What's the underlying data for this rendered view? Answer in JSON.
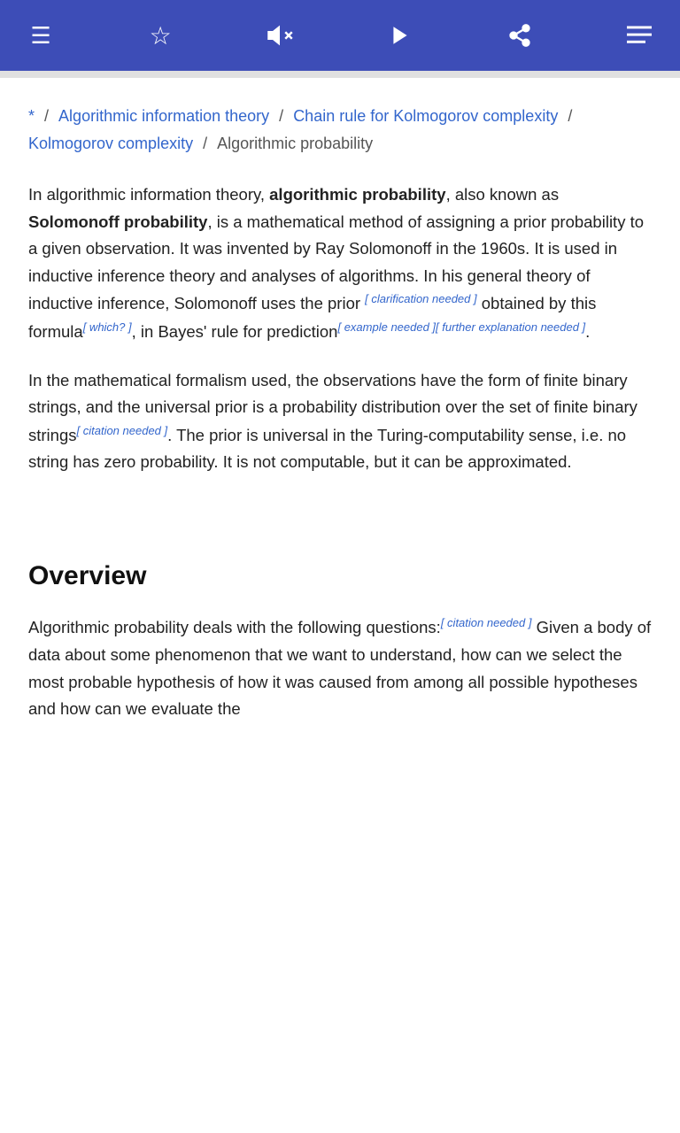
{
  "navbar": {
    "menu_icon": "☰",
    "star_icon": "☆",
    "mute_icon": "🔇",
    "play_icon": "▶",
    "share_icon": "⋯",
    "more_icon": "≡"
  },
  "breadcrumb": {
    "star": "*",
    "link1": "Algorithmic information theory",
    "link2": "Chain rule for Kolmogorov complexity",
    "link3": "Kolmogorov complexity",
    "current": "Algorithmic probability"
  },
  "article": {
    "intro_paragraph": "In algorithmic information theory, algorithmic probability, also known as Solomonoff probability, is a mathematical method of assigning a prior probability to a given observation. It was invented by Ray Solomonoff in the 1960s. It is used in inductive inference theory and analyses of algorithms. In his general theory of inductive inference, Solomonoff uses the prior",
    "ref_clarification": "[ clarification needed ]",
    "intro_part2": "obtained by this formula",
    "ref_which": "[ which? ]",
    "intro_part3": ", in Bayes' rule for prediction",
    "ref_example": "[ example needed ]",
    "ref_further": "[ further explanation needed ]",
    "intro_end": ".",
    "second_paragraph_1": "In the mathematical formalism used, the observations have the form of finite binary strings, and the universal prior is a probability distribution over the set of finite binary strings",
    "ref_citation1": "[ citation needed ]",
    "second_paragraph_2": ". The prior is universal in the Turing-computability sense, i.e. no string has zero probability. It is not computable, but it can be approximated.",
    "overview_heading": "Overview",
    "overview_paragraph": "Algorithmic probability deals with the following questions:",
    "ref_citation2": "[ citation needed ]",
    "overview_paragraph_cont": " Given a body of data about some phenomenon that we want to understand, how can we select the most probable hypothesis of how it was caused from among all possible hypotheses and how can we evaluate the"
  }
}
